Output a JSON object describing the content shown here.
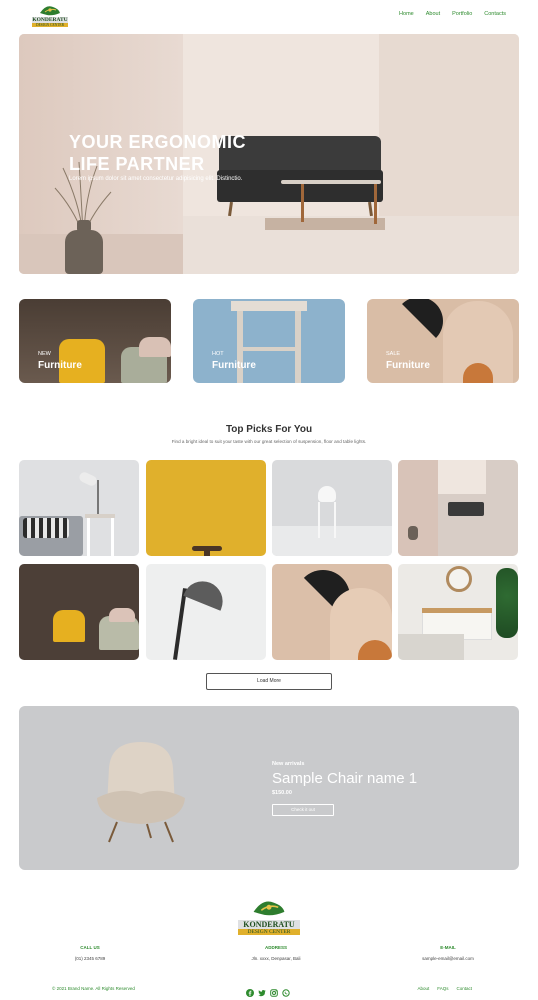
{
  "brand": {
    "name": "KONDERATU",
    "tagline": "DESIGN CENTER"
  },
  "nav": {
    "items": [
      "Home",
      "About",
      "Portfolio",
      "Contacts"
    ]
  },
  "hero": {
    "title_line1": "YOUR ERGONOMIC",
    "title_line2": "LIFE PARTNER",
    "subtitle": "Lorem ipsum dolor sit amet consectetur adipisicing elit. Distinctio."
  },
  "categories": [
    {
      "tag": "NEW",
      "name": "Furniture"
    },
    {
      "tag": "HOT",
      "name": "Furniture"
    },
    {
      "tag": "SALE",
      "name": "Furniture"
    }
  ],
  "top_picks": {
    "title": "Top Picks For You",
    "subtitle": "Find a bright ideal to suit your taste with our great selection of suspension, floor and table lights.",
    "load_more": "Load More"
  },
  "arrivals": {
    "label": "New arrivals",
    "product_name": "Sample Chair name 1",
    "price": "$150.00",
    "button": "Check it out"
  },
  "footer": {
    "call_us_heading": "CALL US",
    "call_us_value": "(01) 2345 6789",
    "address_heading": "ADDRESS",
    "address_value": "Jln. xxxx, Denpasar, Bali",
    "email_heading": "E-MAIL",
    "email_value": "sample-email@email.com",
    "copyright": "© 2021 Brand Name. All Rights Reserved",
    "links": [
      "About",
      "FAQs",
      "Contact"
    ],
    "social_icons": [
      "facebook-icon",
      "twitter-icon",
      "instagram-icon",
      "whatsapp-icon"
    ]
  },
  "colors": {
    "accent_green": "#2e8b2e",
    "logo_green": "#1f4e1f",
    "arrivals_bg": "#c9cacc"
  }
}
